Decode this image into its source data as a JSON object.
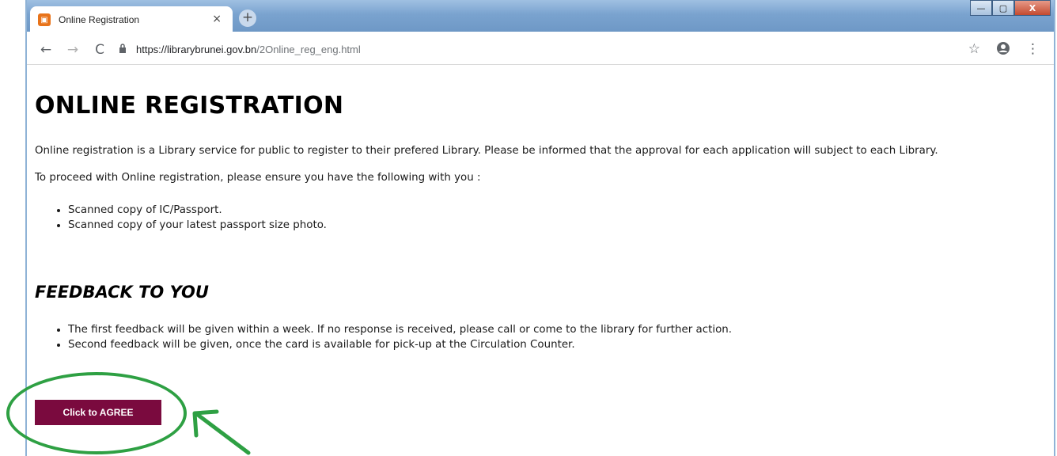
{
  "browser": {
    "tab_title": "Online Registration",
    "tab_close": "×",
    "new_tab": "+",
    "url_domain": "https://librarybrunei.gov.bn",
    "url_path": "/2Online_reg_eng.html",
    "nav": {
      "back": "←",
      "forward": "→",
      "reload": "C"
    },
    "icons": {
      "lock": "lock-icon",
      "star": "star-icon",
      "account": "account-icon",
      "menu": "menu-icon"
    }
  },
  "window_controls": {
    "minimize": "—",
    "maximize": "▢",
    "close": "X"
  },
  "page": {
    "title": "ONLINE REGISTRATION",
    "intro": "Online registration is a Library service for public to register to their prefered Library. Please be informed that the approval for each application will subject to each Library.",
    "proceed_text": "To proceed with Online registration, please ensure you have the following with you :",
    "requirements": [
      "Scanned copy of IC/Passport.",
      "Scanned copy of your latest passport size photo."
    ],
    "feedback_heading": "FEEDBACK TO YOU",
    "feedback_items": [
      "The first feedback will be given within a week. If no response is received, please call or come to the library for further action.",
      "Second feedback will be given, once the card is available for pick-up at the Circulation Counter."
    ],
    "agree_button": "Click to AGREE"
  },
  "colors": {
    "agree_button_bg": "#7a0a3e",
    "annotation": "#2ea043",
    "tab_favicon": "#e8731a"
  }
}
